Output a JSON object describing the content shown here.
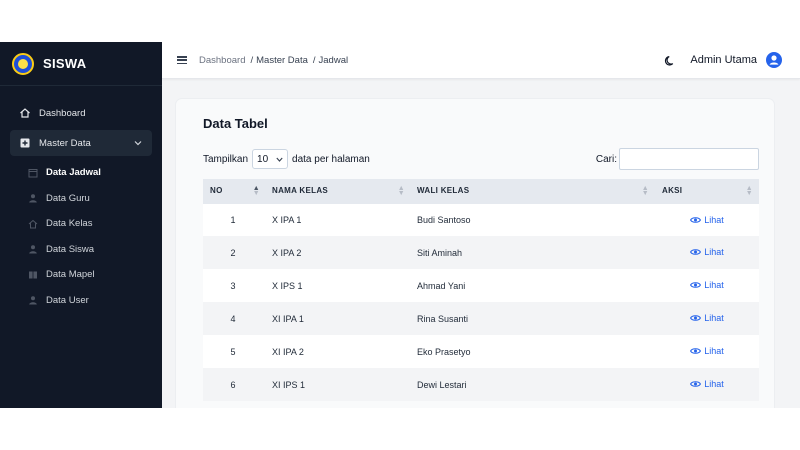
{
  "app": {
    "name": "SISWA"
  },
  "sidebar": {
    "items": [
      {
        "label": "Dashboard",
        "icon": "home-icon"
      },
      {
        "label": "Master Data",
        "icon": "folder-plus-icon",
        "expanded": true,
        "children": [
          {
            "label": "Data Jadwal",
            "icon": "calendar-icon",
            "current": true
          },
          {
            "label": "Data Guru",
            "icon": "user-icon"
          },
          {
            "label": "Data Kelas",
            "icon": "home-icon"
          },
          {
            "label": "Data Siswa",
            "icon": "user-icon"
          },
          {
            "label": "Data Mapel",
            "icon": "book-icon"
          },
          {
            "label": "Data User",
            "icon": "user-icon"
          }
        ]
      }
    ]
  },
  "header": {
    "breadcrumb": [
      "Dashboard",
      "Master Data",
      "Jadwal"
    ],
    "user_name": "Admin Utama"
  },
  "card": {
    "title": "Data Tabel",
    "length_prefix": "Tampilkan",
    "length_value": "10",
    "length_suffix": "data per halaman",
    "search_label": "Cari:",
    "search_value": ""
  },
  "table": {
    "columns": [
      "NO",
      "NAMA KELAS",
      "WALI KELAS",
      "AKSI"
    ],
    "rows": [
      {
        "no": "1",
        "kelas": "X IPA 1",
        "wali": "Budi Santoso",
        "aksi": "Lihat"
      },
      {
        "no": "2",
        "kelas": "X IPA 2",
        "wali": "Siti Aminah",
        "aksi": "Lihat"
      },
      {
        "no": "3",
        "kelas": "X IPS 1",
        "wali": "Ahmad Yani",
        "aksi": "Lihat"
      },
      {
        "no": "4",
        "kelas": "XI IPA 1",
        "wali": "Rina Susanti",
        "aksi": "Lihat"
      },
      {
        "no": "5",
        "kelas": "XI IPA 2",
        "wali": "Eko Prasetyo",
        "aksi": "Lihat"
      },
      {
        "no": "6",
        "kelas": "XI IPS 1",
        "wali": "Dewi Lestari",
        "aksi": "Lihat"
      }
    ]
  },
  "colors": {
    "sidebar_bg": "#111827",
    "accent": "#2563eb",
    "header_row": "#e5e9ef"
  }
}
